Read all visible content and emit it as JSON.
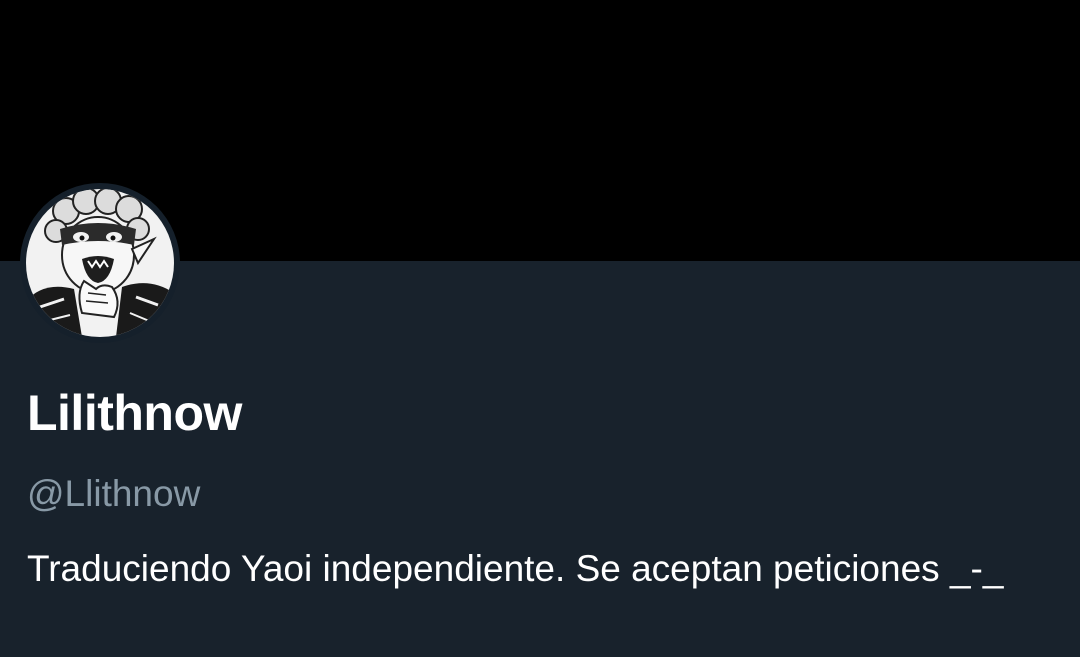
{
  "profile": {
    "display_name": "Lilithnow",
    "handle": "@Llithnow",
    "bio": "Traduciendo Yaoi independiente. Se aceptan peticiones _-_"
  },
  "colors": {
    "banner": "#000000",
    "background": "#18222c",
    "name_text": "#ffffff",
    "handle_text": "#8899a6",
    "bio_text": "#ffffff"
  },
  "icons": {
    "avatar": "manga-character-avatar"
  }
}
